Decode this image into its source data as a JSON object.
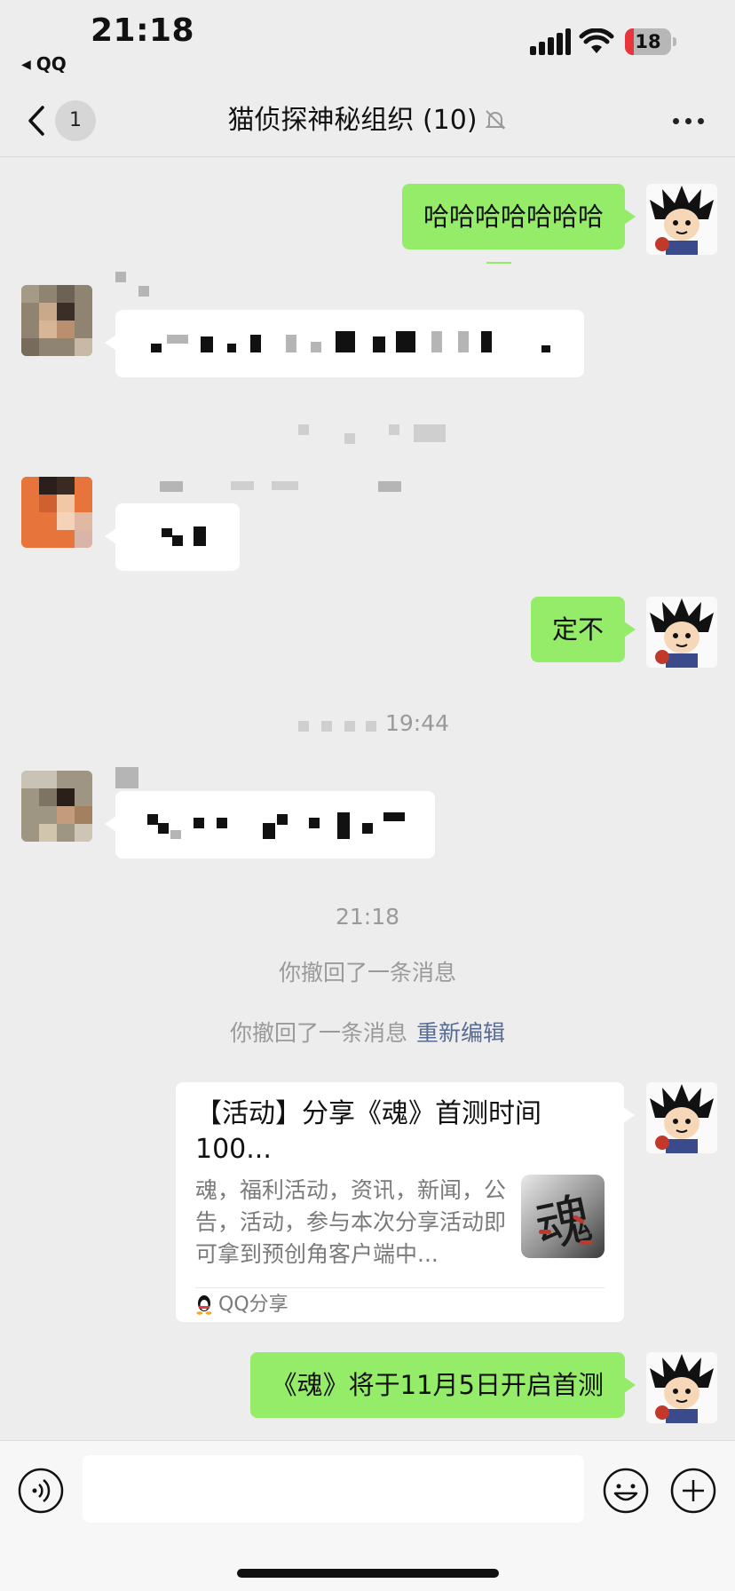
{
  "status_bar": {
    "time": "21:18",
    "back_app": "QQ",
    "battery": "18",
    "battery_color": "#e8343b"
  },
  "nav": {
    "unread_count": "1",
    "title": "猫侦探神秘组织 (10)",
    "icons": {
      "back": "chevron-left-icon",
      "mute": "bell-off-icon",
      "more": "ellipsis-icon"
    }
  },
  "messages": {
    "m1_text": "哈哈哈哈哈哈哈",
    "m4_text": "定不",
    "m6_text": "《魂》将于11月5日开启首测"
  },
  "timestamps": {
    "t1": "19:44",
    "t2": "21:18"
  },
  "system": {
    "recall_1": "你撤回了一条消息",
    "recall_2": "你撤回了一条消息",
    "re_edit": "重新编辑"
  },
  "share_card": {
    "title": "【活动】分享《魂》首测时间100...",
    "description": "魂，福利活动，资讯，新闻，公告，活动，参与本次分享活动即可拿到预创角客户端中...",
    "thumb_char": "魂",
    "source": "QQ分享"
  },
  "colors": {
    "background": "#ededed",
    "green_bubble": "#95ec69",
    "link": "#586b93"
  }
}
